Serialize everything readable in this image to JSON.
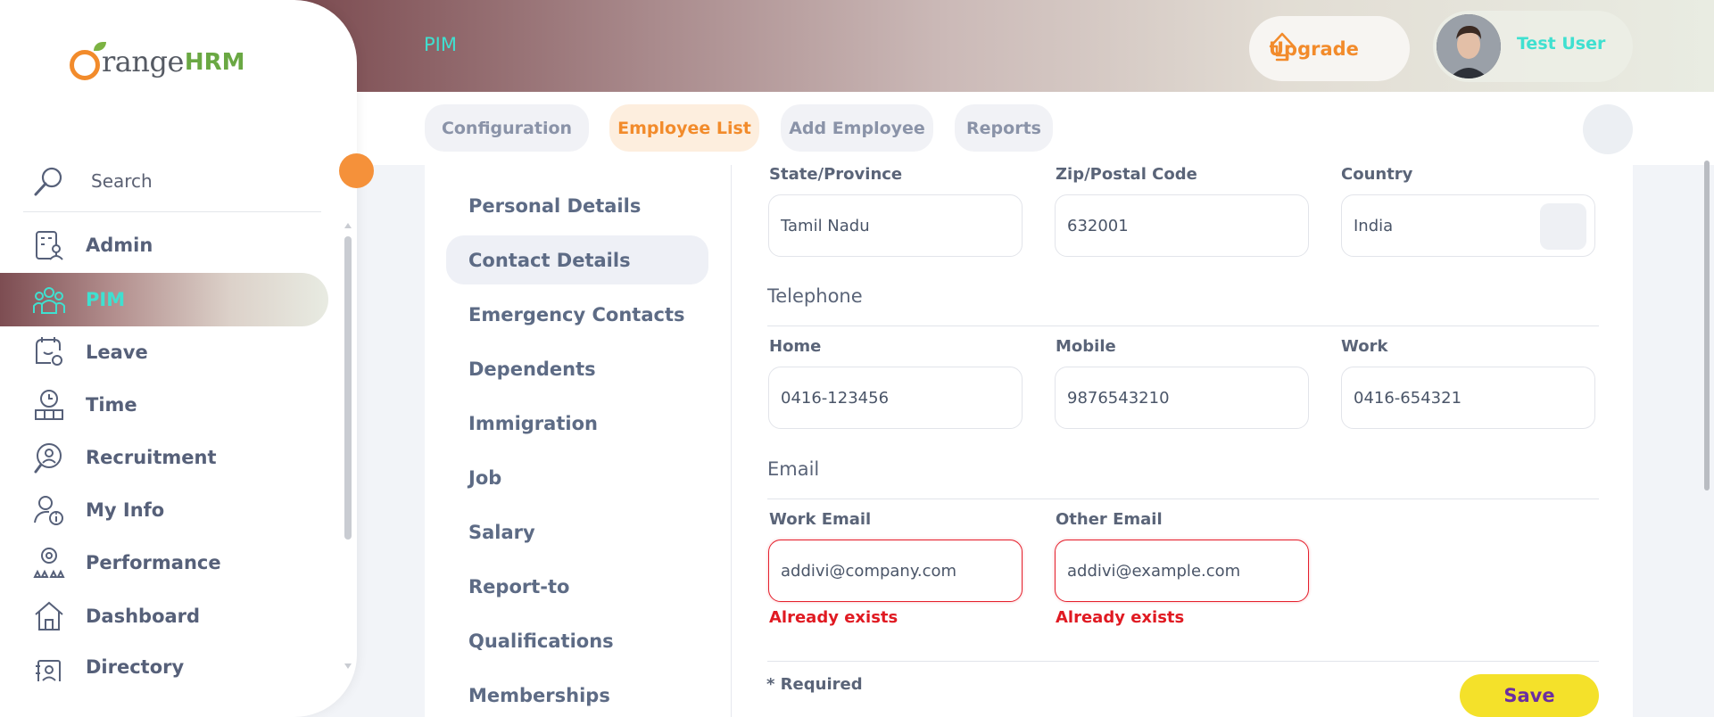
{
  "header": {
    "module_title": "PIM",
    "upgrade_label": "Upgrade",
    "user_name": "Test User"
  },
  "subnav": {
    "tabs": [
      {
        "label": "Configuration",
        "active": false
      },
      {
        "label": "Employee List",
        "active": true
      },
      {
        "label": "Add Employee",
        "active": false
      },
      {
        "label": "Reports",
        "active": false
      }
    ]
  },
  "sidebar": {
    "logo_text_1": "range",
    "logo_text_2": "HRM",
    "search_label": "Search",
    "items": [
      {
        "label": "Admin",
        "icon": "admin-icon"
      },
      {
        "label": "PIM",
        "icon": "pim-icon",
        "active": true
      },
      {
        "label": "Leave",
        "icon": "leave-icon"
      },
      {
        "label": "Time",
        "icon": "time-icon"
      },
      {
        "label": "Recruitment",
        "icon": "recruitment-icon"
      },
      {
        "label": "My Info",
        "icon": "my-info-icon"
      },
      {
        "label": "Performance",
        "icon": "performance-icon"
      },
      {
        "label": "Dashboard",
        "icon": "dashboard-icon"
      },
      {
        "label": "Directory",
        "icon": "directory-icon"
      }
    ]
  },
  "profile_menu": [
    {
      "label": "Personal Details"
    },
    {
      "label": "Contact Details",
      "active": true
    },
    {
      "label": "Emergency Contacts"
    },
    {
      "label": "Dependents"
    },
    {
      "label": "Immigration"
    },
    {
      "label": "Job"
    },
    {
      "label": "Salary"
    },
    {
      "label": "Report-to"
    },
    {
      "label": "Qualifications"
    },
    {
      "label": "Memberships"
    }
  ],
  "form": {
    "address": {
      "state_label": "State/Province",
      "state_value": "Tamil Nadu",
      "zip_label": "Zip/Postal Code",
      "zip_value": "632001",
      "country_label": "Country",
      "country_value": "India"
    },
    "telephone": {
      "section_title": "Telephone",
      "home_label": "Home",
      "home_value": "0416-123456",
      "mobile_label": "Mobile",
      "mobile_value": "9876543210",
      "work_label": "Work",
      "work_value": "0416-654321"
    },
    "email": {
      "section_title": "Email",
      "work_email_label": "Work Email",
      "work_email_value": "addivi@company.com",
      "work_email_error": "Already exists",
      "other_email_label": "Other Email",
      "other_email_value": "addivi@example.com",
      "other_email_error": "Already exists"
    },
    "required_note": "* Required",
    "save_label": "Save"
  },
  "colors": {
    "accent_orange": "#f28b2b",
    "accent_teal": "#3fe0d0",
    "error_red": "#e01a22",
    "save_yellow": "#f4e12a"
  }
}
